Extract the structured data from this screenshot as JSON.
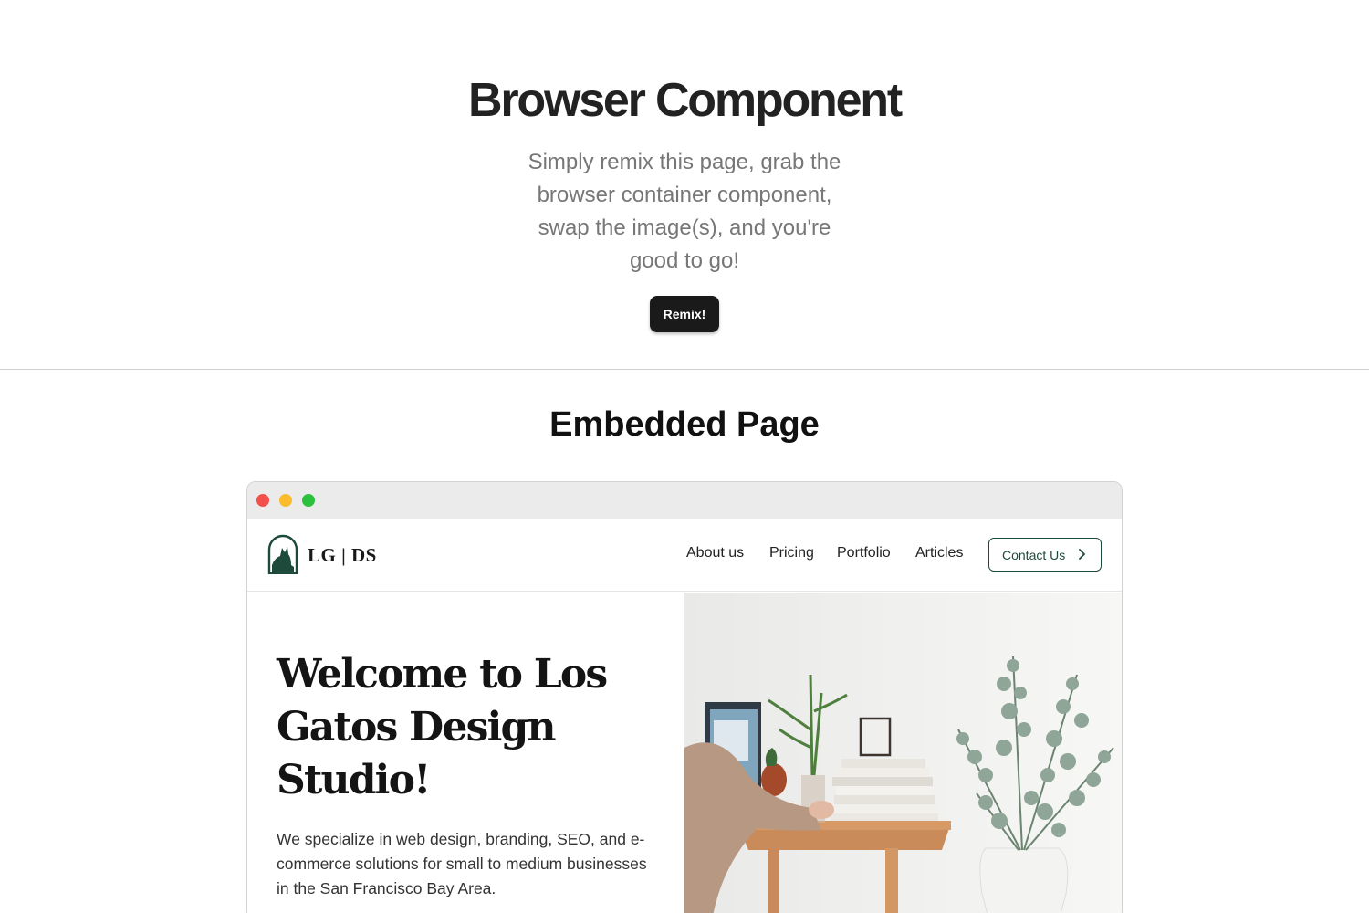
{
  "hero": {
    "title": "Browser Component",
    "subtitle": "Simply remix this page, grab the browser container component, swap the image(s), and you're good to go!",
    "remix_label": "Remix!"
  },
  "section": {
    "title": "Embedded Page"
  },
  "browser": {
    "window_controls": [
      "close",
      "minimize",
      "maximize"
    ],
    "colors": {
      "close": "#f2504b",
      "minimize": "#fbbb2d",
      "maximize": "#2cc03f"
    }
  },
  "site": {
    "logo_text": "LG | DS",
    "brand_color": "#1e4a3c",
    "nav": {
      "about": "About us",
      "pricing": "Pricing",
      "portfolio": "Portfolio",
      "articles": "Articles"
    },
    "contact_label": "Contact Us",
    "welcome_heading": "Welcome to Los Gatos Design Studio!",
    "description": "We specialize in web design, branding, SEO, and e-commerce solutions for small to medium businesses in the San Francisco Bay Area."
  }
}
